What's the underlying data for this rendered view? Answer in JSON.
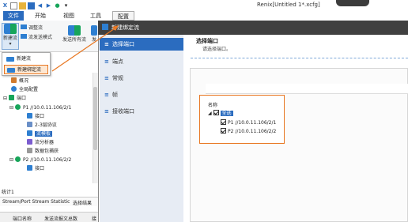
{
  "window": {
    "title": "Renix[Untitled 1*.xcfg]"
  },
  "menu": {
    "file": "文件",
    "start": "开始",
    "view": "视图",
    "tools": "工具",
    "config": "配置"
  },
  "ribbon": {
    "adjust_stream": "调整流",
    "stream_send_mode": "流发送模式",
    "new_stream": "新建流",
    "send_all_streams": "发送所有流",
    "partial": "发"
  },
  "dropdown": {
    "new_stream": "新建流",
    "new_binding_stream": "新建绑定流"
  },
  "tree": {
    "overview": "概况",
    "global_config": "全局配置",
    "port": "端口",
    "port1": "P1 //10.0.11.106/2/1",
    "interface": "接口",
    "protocol": "2-3层协议",
    "stream_template": "流模板",
    "stream_analyzer": "流分析器",
    "capture": "数据包捕获",
    "port2": "P2 //10.0.11.106/2/2",
    "interface2": "接口"
  },
  "bottom": {
    "stat": "统计1",
    "tab1": "Stream/Port Stream Statistic",
    "tab2": "选择结果",
    "col1": "端口名称",
    "col2": "发送流报文总数",
    "col3": "接"
  },
  "dialog": {
    "title": "新建绑定流",
    "nav": [
      "选择端口",
      "端点",
      "常规",
      "帧",
      "接收端口"
    ],
    "pane_title": "选择端口",
    "pane_subtitle": "请选择端口。",
    "list_header": "名称",
    "select_all": "全选",
    "port1": "P1 //10.0.11.106/2/1",
    "port2": "P2 //10.0.11.106/2/2"
  },
  "colors": {
    "accent": "#2b6cbf",
    "highlight": "#e87722",
    "dialog_title_bg": "#404040"
  }
}
